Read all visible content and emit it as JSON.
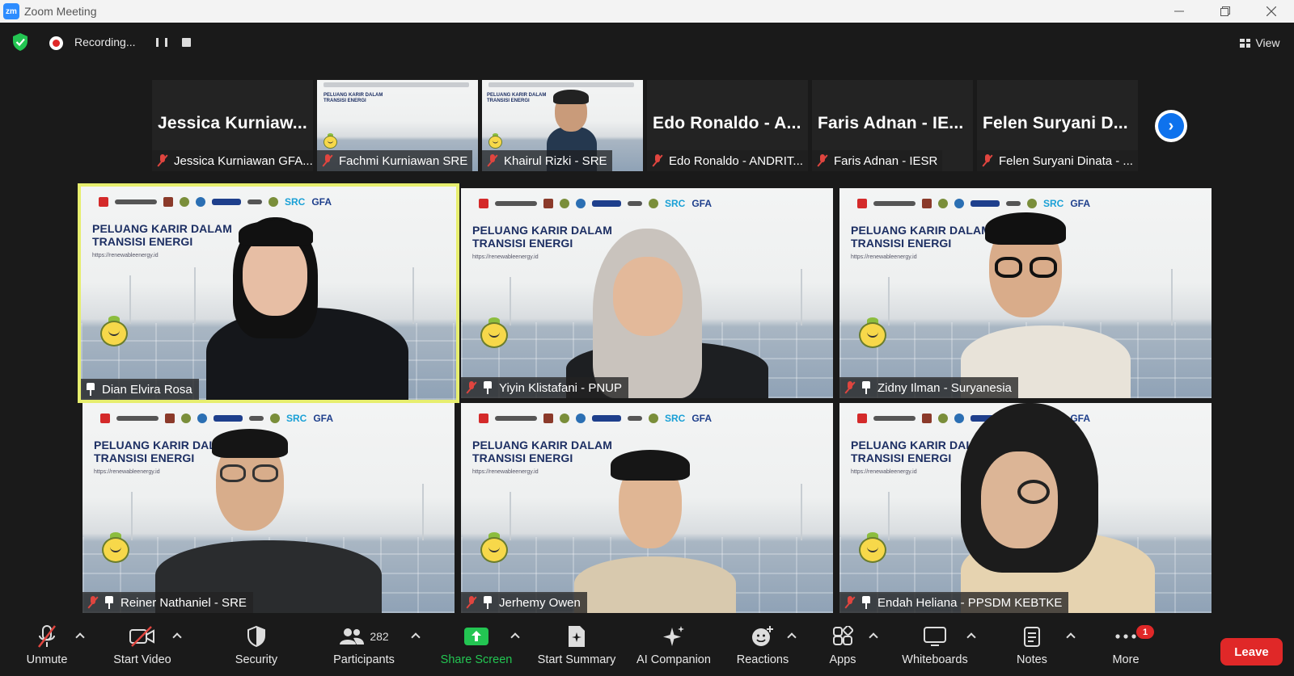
{
  "window": {
    "logo": "zm",
    "title": "Zoom Meeting",
    "minimize_icon": "minimize-icon",
    "maximize_icon": "restore-icon",
    "close_icon": "close-icon"
  },
  "topbar": {
    "recording_label": "Recording...",
    "view_label": "View",
    "security_color": "#23c552",
    "recording_color": "#e02828"
  },
  "filmstrip": [
    {
      "big_name": "Jessica Kurniaw...",
      "label": "Jessica Kurniawan GFA...",
      "muted": true,
      "video": false
    },
    {
      "big_name": "",
      "label": "Fachmi Kurniawan SRE",
      "muted": true,
      "video": true
    },
    {
      "big_name": "",
      "label": "Khairul Rizki - SRE",
      "muted": true,
      "video": true
    },
    {
      "big_name": "Edo Ronaldo - A...",
      "label": "Edo Ronaldo - ANDRIT...",
      "muted": true,
      "video": false
    },
    {
      "big_name": "Faris Adnan - IE...",
      "label": "Faris Adnan - IESR",
      "muted": true,
      "video": false
    },
    {
      "big_name": "Felen Suryani D...",
      "label": "Felen Suryani Dinata - ...",
      "muted": true,
      "video": false
    }
  ],
  "slide": {
    "headline_line1": "PELUANG KARIR DALAM",
    "headline_line2": "TRANSISI ENERGI",
    "url": "https://renewableenergy.id",
    "logo_text_1": "SRC",
    "logo_text_2": "GFA"
  },
  "tiles": [
    {
      "name": "Dian Elvira Rosa",
      "muted": false,
      "pinned": true,
      "active": true
    },
    {
      "name": "Yiyin Klistafani - PNUP",
      "muted": true,
      "pinned": true,
      "active": false
    },
    {
      "name": "Zidny Ilman - Suryanesia",
      "muted": true,
      "pinned": true,
      "active": false
    },
    {
      "name": "Reiner Nathaniel - SRE",
      "muted": true,
      "pinned": true,
      "active": false
    },
    {
      "name": "Jerhemy Owen",
      "muted": true,
      "pinned": true,
      "active": false
    },
    {
      "name": "Endah Heliana - PPSDM KEBTKE",
      "muted": true,
      "pinned": true,
      "active": false
    }
  ],
  "toolbar": {
    "unmute": "Unmute",
    "start_video": "Start Video",
    "security": "Security",
    "participants": "Participants",
    "participants_count": "282",
    "share_screen": "Share Screen",
    "start_summary": "Start Summary",
    "ai_companion": "AI Companion",
    "reactions": "Reactions",
    "apps": "Apps",
    "whiteboards": "Whiteboards",
    "notes": "Notes",
    "more": "More",
    "more_badge": "1",
    "leave": "Leave"
  }
}
